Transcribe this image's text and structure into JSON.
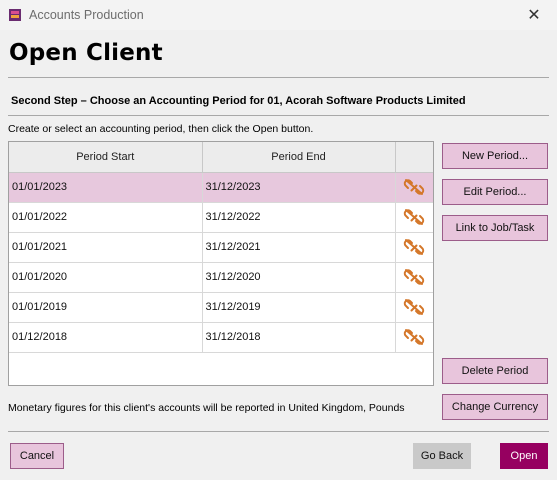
{
  "window": {
    "title": "Accounts Production",
    "close_glyph": "✕"
  },
  "page": {
    "title": "Open Client",
    "step_heading": "Second Step – Choose an Accounting Period for 01, Acorah Software Products Limited",
    "instructions": "Create or select an accounting period, then click the Open button."
  },
  "table": {
    "columns": [
      "Period Start",
      "Period End",
      ""
    ],
    "rows": [
      {
        "start": "01/01/2023",
        "end": "31/12/2023",
        "icon": "unlink-icon",
        "selected": true
      },
      {
        "start": "01/01/2022",
        "end": "31/12/2022",
        "icon": "unlink-icon",
        "selected": false
      },
      {
        "start": "01/01/2021",
        "end": "31/12/2021",
        "icon": "unlink-icon",
        "selected": false
      },
      {
        "start": "01/01/2020",
        "end": "31/12/2020",
        "icon": "unlink-icon",
        "selected": false
      },
      {
        "start": "01/01/2019",
        "end": "31/12/2019",
        "icon": "unlink-icon",
        "selected": false
      },
      {
        "start": "01/12/2018",
        "end": "31/12/2018",
        "icon": "unlink-icon",
        "selected": false
      }
    ]
  },
  "side_buttons": {
    "new_period": "New Period...",
    "edit_period": "Edit Period...",
    "link_job": "Link to Job/Task",
    "delete_period": "Delete Period",
    "change_currency": "Change Currency"
  },
  "currency_note": "Monetary figures for this client's accounts will be reported in United Kingdom, Pounds",
  "footer": {
    "cancel": "Cancel",
    "go_back": "Go Back",
    "open": "Open"
  },
  "colors": {
    "accent": "#960060",
    "button_fill": "#e8c5dc",
    "selected_row": "#e7c8dd",
    "icon_orange": "#d4772a"
  }
}
